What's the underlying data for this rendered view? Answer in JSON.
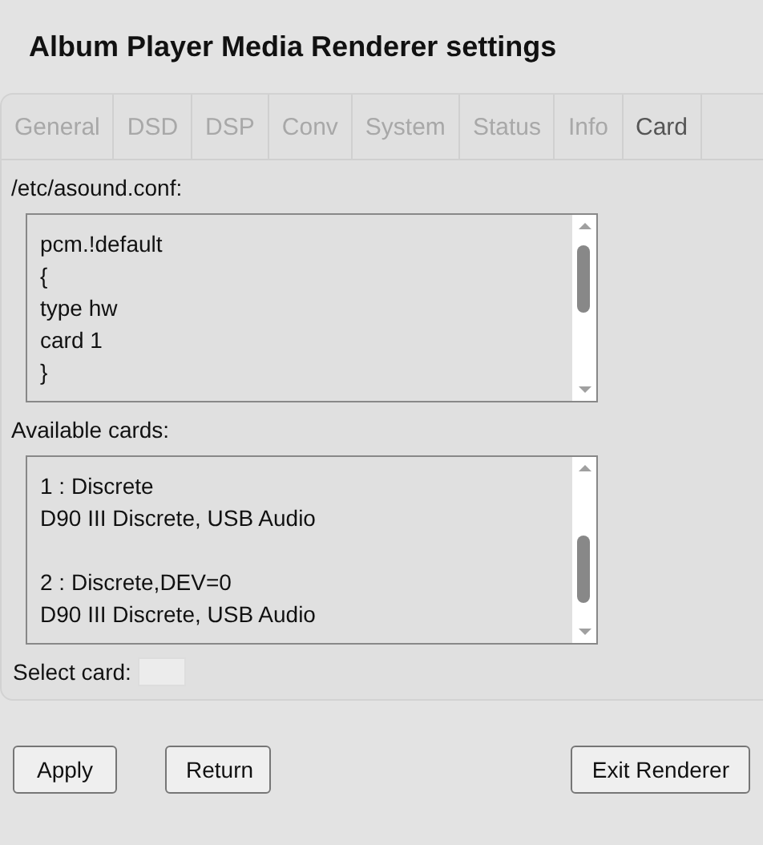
{
  "window": {
    "title": "Album Player Media Renderer settings"
  },
  "tabs": [
    {
      "label": "General",
      "selected": false
    },
    {
      "label": "DSD",
      "selected": false
    },
    {
      "label": "DSP",
      "selected": false
    },
    {
      "label": "Conv",
      "selected": false
    },
    {
      "label": "System",
      "selected": false
    },
    {
      "label": "Status",
      "selected": false
    },
    {
      "label": "Info",
      "selected": false
    },
    {
      "label": "Card",
      "selected": true
    }
  ],
  "config": {
    "label": "/etc/asound.conf:",
    "lines": [
      "pcm.!default",
      "{",
      "type hw",
      "card 1",
      "}"
    ]
  },
  "cards": {
    "label": "Available cards:",
    "items": [
      {
        "name": "1 : Discrete",
        "description": "D90 III Discrete, USB Audio"
      },
      {
        "name": "2 : Discrete,DEV=0",
        "description": "D90 III Discrete, USB Audio"
      }
    ]
  },
  "select_card": {
    "label": "Select card:"
  },
  "buttons": [
    "Apply",
    "Return",
    "Exit Renderer"
  ]
}
